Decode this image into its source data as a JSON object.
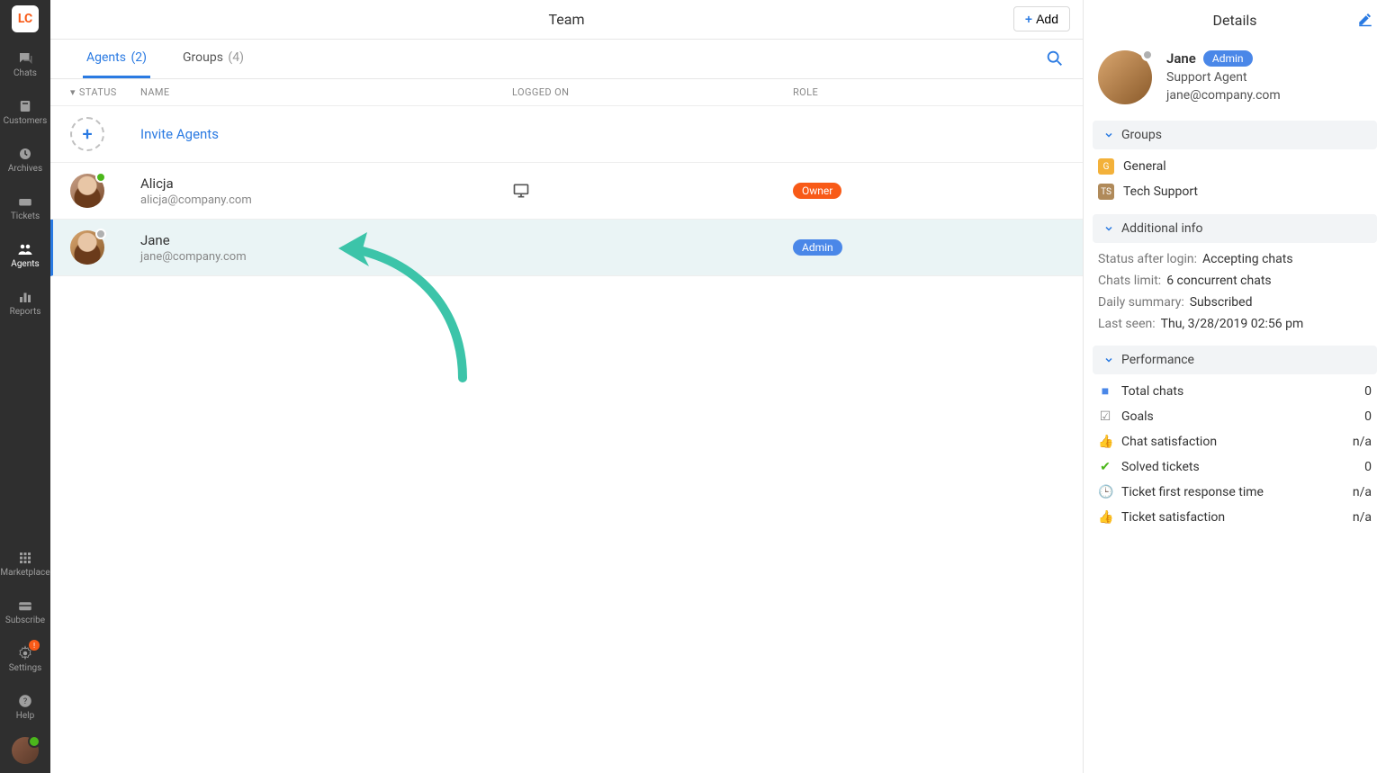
{
  "nav": {
    "logo": "LC",
    "items": [
      {
        "label": "Chats"
      },
      {
        "label": "Customers"
      },
      {
        "label": "Archives"
      },
      {
        "label": "Tickets"
      },
      {
        "label": "Agents"
      },
      {
        "label": "Reports"
      }
    ],
    "bottom_items": [
      {
        "label": "Marketplace"
      },
      {
        "label": "Subscribe"
      },
      {
        "label": "Settings"
      },
      {
        "label": "Help"
      }
    ],
    "settings_alert": "!"
  },
  "header": {
    "title": "Team",
    "add_label": "Add"
  },
  "tabs": {
    "agents_label": "Agents",
    "agents_count": "(2)",
    "groups_label": "Groups",
    "groups_count": "(4)"
  },
  "columns": {
    "status": "STATUS",
    "name": "NAME",
    "logged_on": "LOGGED ON",
    "role": "ROLE"
  },
  "invite": {
    "label": "Invite Agents"
  },
  "agents": [
    {
      "name": "Alicja",
      "email": "alicja@company.com",
      "presence": "online",
      "device": "desktop",
      "role": "Owner"
    },
    {
      "name": "Jane",
      "email": "jane@company.com",
      "presence": "offline",
      "device": "",
      "role": "Admin"
    }
  ],
  "details": {
    "title": "Details",
    "profile": {
      "name": "Jane",
      "role": "Admin",
      "subtitle": "Support Agent",
      "email": "jane@company.com"
    },
    "sections": {
      "groups": "Groups",
      "additional_info": "Additional info",
      "performance": "Performance"
    },
    "groups": [
      {
        "badge": "G",
        "label": "General"
      },
      {
        "badge": "TS",
        "label": "Tech Support"
      }
    ],
    "additional_info": {
      "status_after_login_k": "Status after login:",
      "status_after_login_v": "Accepting chats",
      "chats_limit_k": "Chats limit:",
      "chats_limit_v": "6 concurrent chats",
      "daily_summary_k": "Daily summary:",
      "daily_summary_v": "Subscribed",
      "last_seen_k": "Last seen:",
      "last_seen_v": "Thu, 3/28/2019 02:56 pm"
    },
    "performance": [
      {
        "icon": "chat",
        "label": "Total chats",
        "value": "0"
      },
      {
        "icon": "check",
        "label": "Goals",
        "value": "0"
      },
      {
        "icon": "thumb",
        "label": "Chat satisfaction",
        "value": "n/a"
      },
      {
        "icon": "solved",
        "label": "Solved tickets",
        "value": "0"
      },
      {
        "icon": "clock",
        "label": "Ticket first response time",
        "value": "n/a"
      },
      {
        "icon": "thumb",
        "label": "Ticket satisfaction",
        "value": "n/a"
      }
    ]
  }
}
